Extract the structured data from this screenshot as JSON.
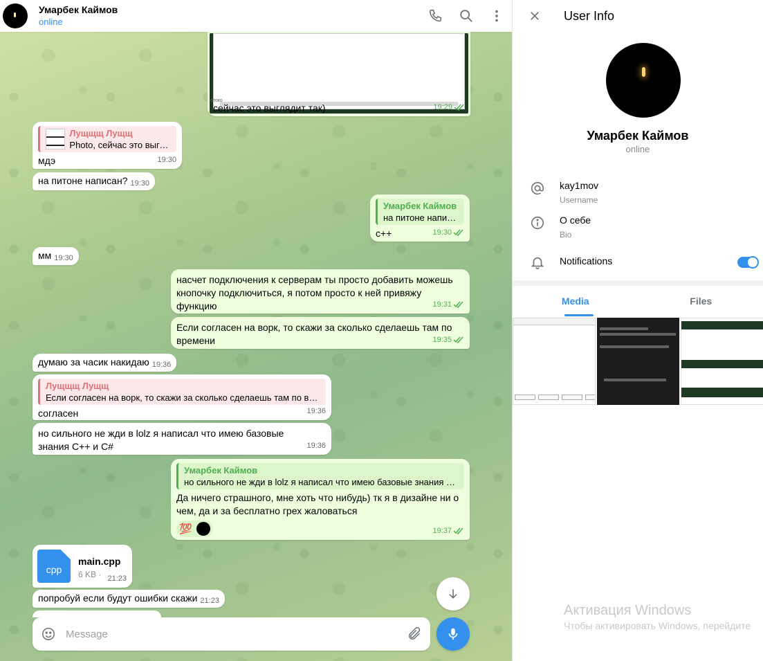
{
  "header": {
    "name": "Умарбек Каймов",
    "status": "online"
  },
  "messages": {
    "m1": {
      "text": "сейчас это выглядит так)",
      "time": "19:29",
      "caption_small": "отоко"
    },
    "m2": {
      "quote_name": "Лущщщ Лущщ",
      "quote_text": "Photo, сейчас это выгля...",
      "text": "мдэ",
      "time": "19:30"
    },
    "m3": {
      "text": "на питоне написан?",
      "time": "19:30"
    },
    "m4": {
      "quote_name": "Умарбек Каймов",
      "quote_text": "на питоне написан?",
      "text": "c++",
      "time": "19:30"
    },
    "m5": {
      "text": "мм",
      "time": "19:30"
    },
    "m6": {
      "text": "насчет подключения к серверам ты просто добавить можешь кнопочку подключиться, я потом просто к ней привяжу функцию",
      "time": "19:31"
    },
    "m7": {
      "text": "Если согласен на ворк, то скажи за сколько сделаешь там по времени",
      "time": "19:35"
    },
    "m8": {
      "text": "думаю за часик накидаю",
      "time": "19:36"
    },
    "m9": {
      "quote_name": "Лущщщ Лущщ",
      "quote_text": "Если согласен на ворк, то скажи за сколько сделаешь там по вре...",
      "text": "согласен",
      "time": "19:36"
    },
    "m10": {
      "text": "но сильного не жди в lolz я написал что имею базовые знания C++ и C#",
      "time": "19:36"
    },
    "m11": {
      "quote_name": "Умарбек Каймов",
      "quote_text": "но сильного не жди в lolz я написал что имею базовые знания C+...",
      "text": "Да ничего страшного, мне хоть что нибудь) тк я в дизайне ни о чем, да и за бесплатно грех жаловаться",
      "reaction": "💯",
      "time": "19:37"
    },
    "m12": {
      "file_ext": "cpp",
      "file_name": "main.cpp",
      "file_size": "6 KB ·",
      "time": "21:23"
    },
    "m13": {
      "text": "попробуй если будут ошибки скажи",
      "time": "21:23"
    }
  },
  "composer": {
    "placeholder": "Message"
  },
  "info": {
    "title": "User Info",
    "name": "Умарбек Каймов",
    "status": "online",
    "username": "kay1mov",
    "username_label": "Username",
    "bio": "О себе",
    "bio_label": "Bio",
    "notifications_label": "Notifications",
    "notifications_on": true,
    "tabs": [
      "Media",
      "Files"
    ],
    "active_tab": "Media"
  },
  "watermark": {
    "title": "Активация Windows",
    "subtitle": "Чтобы активировать Windows, перейдите"
  },
  "colors": {
    "accent": "#3390ec",
    "outgoing_bubble": "#eeffde",
    "check_green": "#4fae4e",
    "quote_red": "#e17076"
  },
  "icons": [
    "phone-icon",
    "search-icon",
    "more-vertical-icon",
    "close-icon",
    "at-icon",
    "info-icon",
    "bell-icon",
    "emoji-icon",
    "attach-icon",
    "mic-icon",
    "arrow-down-icon",
    "double-check-icon",
    "cpp-file-icon"
  ]
}
